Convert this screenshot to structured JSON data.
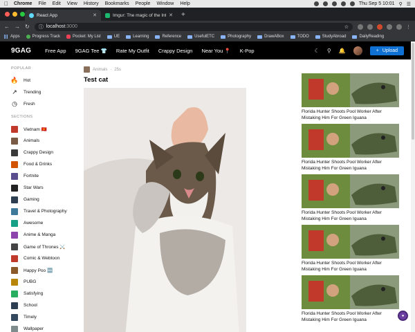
{
  "menubar": {
    "app": "Chrome",
    "items": [
      "File",
      "Edit",
      "View",
      "History",
      "Bookmarks",
      "People",
      "Window",
      "Help"
    ],
    "clock": "Thu Sep 5  10:01"
  },
  "tabs": [
    {
      "title": "React App",
      "active": true
    },
    {
      "title": "Imgur: The magic of the Intern",
      "active": false
    }
  ],
  "toolbar": {
    "url_host": "localhost",
    "url_port": ":3000"
  },
  "bookmarks": [
    "Apps",
    "Progress Track",
    "Pocket: My List",
    "UE",
    "Learning",
    "Reference",
    "UsefulETC",
    "Photography",
    "DrawABox",
    "TODO",
    "StudyAbroad",
    "DailyReading"
  ],
  "nav": {
    "logo": "9GAG",
    "links": [
      "Free App",
      "9GAG Tee 👕",
      "Rate My Outfit",
      "Crappy Design",
      "Near You 📍",
      "K-Pop"
    ],
    "upload": "Upload"
  },
  "sidebar": {
    "popular_head": "POPULAR",
    "popular": [
      "Hot",
      "Trending",
      "Fresh"
    ],
    "sections_head": "SECTIONS",
    "sections": [
      "Vietnam 🇻🇳",
      "Animals",
      "Crappy Design",
      "Food & Drinks",
      "Fortnite",
      "Star Wars",
      "Gaming",
      "Travel & Photography",
      "Awesome",
      "Anime & Manga",
      "Game of Thrones ⚔️",
      "Comic & Webtoon",
      "Happy Poo 🆕",
      "PUBG",
      "Satisfying",
      "School",
      "Timely",
      "Wallpaper"
    ],
    "colors": {
      "section_thumbs": [
        "#c0392b",
        "#7a5c46",
        "#3a3a3a",
        "#d35400",
        "#5b4e8f",
        "#222222",
        "#2c3e50",
        "#3d7a9c",
        "#16a085",
        "#8e44ad",
        "#444444",
        "#c0392b",
        "#8b5a2b",
        "#b8860b",
        "#27ae60",
        "#2c3e50",
        "#34495e",
        "#7f8c8d"
      ]
    }
  },
  "post": {
    "category": "Animals",
    "time": "25s",
    "title": "Test cat"
  },
  "related": [
    {
      "caption": "Florida Hunter Shoots Pool Worker After Mistaking Him For Green Iguana"
    },
    {
      "caption": "Florida Hunter Shoots Pool Worker After Mistaking Him For Green Iguana"
    },
    {
      "caption": "Florida Hunter Shoots Pool Worker After Mistaking Him For Green Iguana"
    },
    {
      "caption": "Florida Hunter Shoots Pool Worker After Mistaking Him For Green Iguana"
    },
    {
      "caption": "Florida Hunter Shoots Pool Worker After Mistaking Him For Green Iguana"
    }
  ],
  "colors": {
    "accent": "#0f71d4",
    "nav_bg": "#000000"
  }
}
